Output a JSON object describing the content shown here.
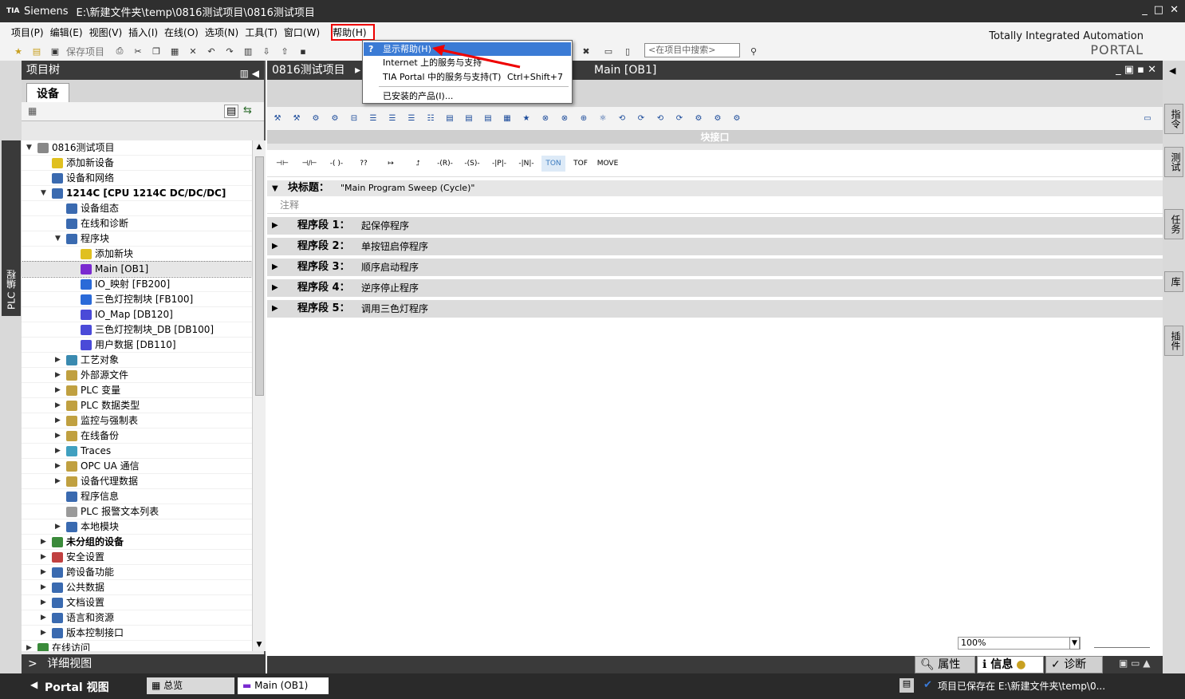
{
  "window": {
    "app": "Siemens",
    "path": "E:\\新建文件夹\\temp\\0816测试项目\\0816测试项目"
  },
  "menu": [
    "项目(P)",
    "编辑(E)",
    "视图(V)",
    "插入(I)",
    "在线(O)",
    "选项(N)",
    "工具(T)",
    "窗口(W)",
    "帮助(H)"
  ],
  "toolbar": {
    "save_label": "保存项目",
    "search_placeholder": "<在项目中搜索>"
  },
  "brand": {
    "line1": "Totally Integrated Automation",
    "line2": "PORTAL"
  },
  "help_menu": {
    "items": [
      {
        "label": "显示帮助(H)",
        "shortcut": ""
      },
      {
        "label": "Internet 上的服务与支持",
        "shortcut": ""
      },
      {
        "label": "TIA Portal 中的服务与支持(T)",
        "shortcut": "Ctrl+Shift+7"
      },
      {
        "label": "已安装的产品(I)...",
        "shortcut": ""
      }
    ]
  },
  "left_strip": {
    "plc_tab": "PLC 编程"
  },
  "tree": {
    "title": "项目树",
    "tab": "设备",
    "detail": "详细视图",
    "rows": [
      {
        "label": "0816测试项目",
        "indent": 0,
        "arrow": "▼",
        "color": "#888"
      },
      {
        "label": "添加新设备",
        "indent": 1,
        "arrow": "",
        "color": "#e0c020"
      },
      {
        "label": "设备和网络",
        "indent": 1,
        "arrow": "",
        "color": "#3a6ab0"
      },
      {
        "label": "1214C [CPU 1214C DC/DC/DC]",
        "indent": 1,
        "arrow": "▼",
        "color": "#3a6ab0",
        "bold": true
      },
      {
        "label": "设备组态",
        "indent": 2,
        "arrow": "",
        "color": "#3a6ab0"
      },
      {
        "label": "在线和诊断",
        "indent": 2,
        "arrow": "",
        "color": "#3a6ab0"
      },
      {
        "label": "程序块",
        "indent": 2,
        "arrow": "▼",
        "color": "#3a6ab0"
      },
      {
        "label": "添加新块",
        "indent": 3,
        "arrow": "",
        "color": "#e0c020"
      },
      {
        "label": "Main [OB1]",
        "indent": 3,
        "arrow": "",
        "color": "#7a2ad0",
        "sel": true
      },
      {
        "label": "IO_映射 [FB200]",
        "indent": 3,
        "arrow": "",
        "color": "#2a6ad8"
      },
      {
        "label": "三色灯控制块 [FB100]",
        "indent": 3,
        "arrow": "",
        "color": "#2a6ad8"
      },
      {
        "label": "IO_Map [DB120]",
        "indent": 3,
        "arrow": "",
        "color": "#4a4ad8"
      },
      {
        "label": "三色灯控制块_DB [DB100]",
        "indent": 3,
        "arrow": "",
        "color": "#4a4ad8"
      },
      {
        "label": "用户数据 [DB110]",
        "indent": 3,
        "arrow": "",
        "color": "#4a4ad8"
      },
      {
        "label": "工艺对象",
        "indent": 2,
        "arrow": "▶",
        "color": "#3a8ab0"
      },
      {
        "label": "外部源文件",
        "indent": 2,
        "arrow": "▶",
        "color": "#c0a040"
      },
      {
        "label": "PLC 变量",
        "indent": 2,
        "arrow": "▶",
        "color": "#c0a040"
      },
      {
        "label": "PLC 数据类型",
        "indent": 2,
        "arrow": "▶",
        "color": "#c0a040"
      },
      {
        "label": "监控与强制表",
        "indent": 2,
        "arrow": "▶",
        "color": "#c0a040"
      },
      {
        "label": "在线备份",
        "indent": 2,
        "arrow": "▶",
        "color": "#c0a040"
      },
      {
        "label": "Traces",
        "indent": 2,
        "arrow": "▶",
        "color": "#40a0c0"
      },
      {
        "label": "OPC UA 通信",
        "indent": 2,
        "arrow": "▶",
        "color": "#c0a040"
      },
      {
        "label": "设备代理数据",
        "indent": 2,
        "arrow": "▶",
        "color": "#c0a040"
      },
      {
        "label": "程序信息",
        "indent": 2,
        "arrow": "",
        "color": "#3a6ab0"
      },
      {
        "label": "PLC 报警文本列表",
        "indent": 2,
        "arrow": "",
        "color": "#999"
      },
      {
        "label": "本地模块",
        "indent": 2,
        "arrow": "▶",
        "color": "#3a6ab0"
      },
      {
        "label": "未分组的设备",
        "indent": 1,
        "arrow": "▶",
        "color": "#3a8a3a",
        "bold": true
      },
      {
        "label": "安全设置",
        "indent": 1,
        "arrow": "▶",
        "color": "#c04040"
      },
      {
        "label": "跨设备功能",
        "indent": 1,
        "arrow": "▶",
        "color": "#3a6ab0"
      },
      {
        "label": "公共数据",
        "indent": 1,
        "arrow": "▶",
        "color": "#3a6ab0"
      },
      {
        "label": "文档设置",
        "indent": 1,
        "arrow": "▶",
        "color": "#3a6ab0"
      },
      {
        "label": "语言和资源",
        "indent": 1,
        "arrow": "▶",
        "color": "#3a6ab0"
      },
      {
        "label": "版本控制接口",
        "indent": 1,
        "arrow": "▶",
        "color": "#3a6ab0"
      },
      {
        "label": "在线访问",
        "indent": 0,
        "arrow": "▶",
        "color": "#3a8a3a"
      }
    ]
  },
  "editor": {
    "breadcrumb": "0816测试项目",
    "title": "Main [OB1]",
    "interface_label": "块接口",
    "ladder": [
      "⊣⊢",
      "⊣/⊢",
      "-( )-",
      "??",
      "↦",
      "⮥",
      "-(R)-",
      "-(S)-",
      "-|P|-",
      "-|N|-",
      "TON",
      "TOF",
      "MOVE"
    ],
    "block_title_label": "块标题：",
    "block_title": "\"Main Program Sweep (Cycle)\"",
    "comment": "注释",
    "segments": [
      {
        "n": "程序段 1：",
        "d": "起保停程序"
      },
      {
        "n": "程序段 2：",
        "d": "单按钮启停程序"
      },
      {
        "n": "程序段 3：",
        "d": "顺序启动程序"
      },
      {
        "n": "程序段 4：",
        "d": "逆序停止程序"
      },
      {
        "n": "程序段 5：",
        "d": "调用三色灯程序"
      }
    ],
    "zoom": "100%"
  },
  "right_tabs": [
    "指令",
    "测试",
    "任务",
    "库",
    "插件"
  ],
  "bottom_tabs": [
    "属性",
    "信息",
    "诊断"
  ],
  "status": {
    "portal": "Portal 视图",
    "tab1": "总览",
    "tab2": "Main (OB1)",
    "message": "项目已保存在 E:\\新建文件夹\\temp\\0..."
  }
}
